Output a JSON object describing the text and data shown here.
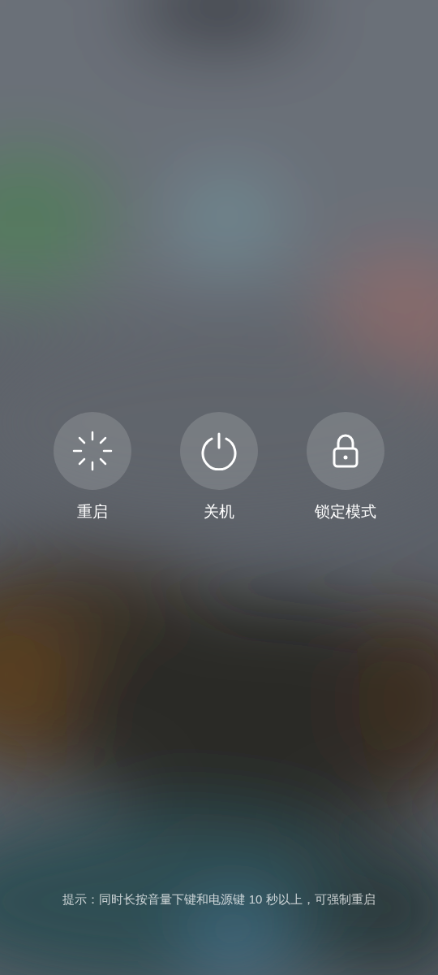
{
  "actions": [
    {
      "kind": "restart",
      "label": "重启"
    },
    {
      "kind": "power",
      "label": "关机"
    },
    {
      "kind": "lock",
      "label": "锁定模式"
    }
  ],
  "hint": "提示：同时长按音量下键和电源键 10 秒以上，可强制重启"
}
